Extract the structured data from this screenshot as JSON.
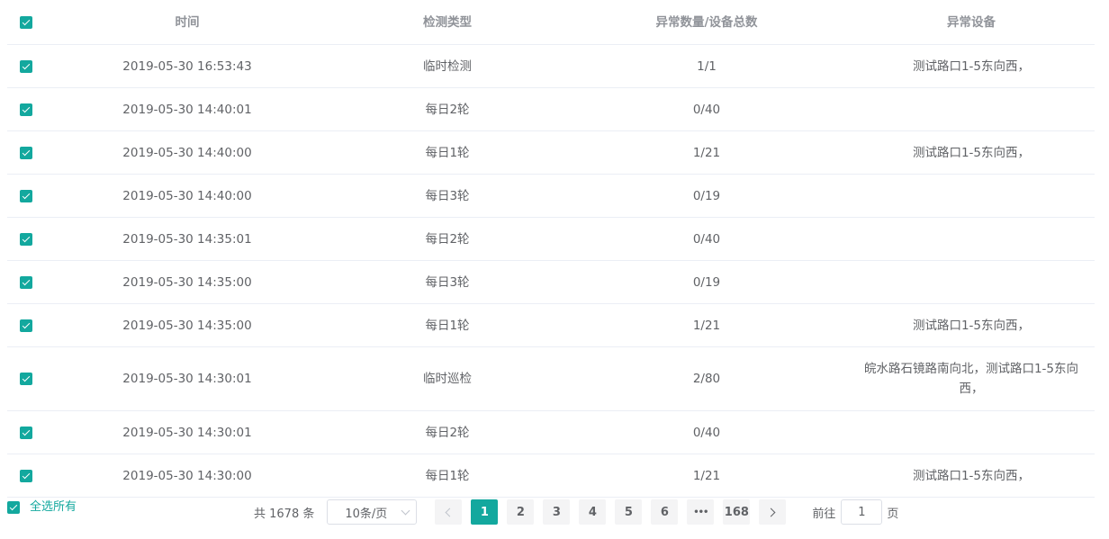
{
  "table": {
    "columns": {
      "time": "时间",
      "type": "检测类型",
      "count": "异常数量/设备总数",
      "device": "异常设备"
    },
    "rows": [
      {
        "time": "2019-05-30 16:53:43",
        "type": "临时检测",
        "count": "1/1",
        "device": "测试路口1-5东向西，"
      },
      {
        "time": "2019-05-30 14:40:01",
        "type": "每日2轮",
        "count": "0/40",
        "device": ""
      },
      {
        "time": "2019-05-30 14:40:00",
        "type": "每日1轮",
        "count": "1/21",
        "device": "测试路口1-5东向西，"
      },
      {
        "time": "2019-05-30 14:40:00",
        "type": "每日3轮",
        "count": "0/19",
        "device": ""
      },
      {
        "time": "2019-05-30 14:35:01",
        "type": "每日2轮",
        "count": "0/40",
        "device": ""
      },
      {
        "time": "2019-05-30 14:35:00",
        "type": "每日3轮",
        "count": "0/19",
        "device": ""
      },
      {
        "time": "2019-05-30 14:35:00",
        "type": "每日1轮",
        "count": "1/21",
        "device": "测试路口1-5东向西，"
      },
      {
        "time": "2019-05-30 14:30:01",
        "type": "临时巡检",
        "count": "2/80",
        "device": "皖水路石镜路南向北，测试路口1-5东向西，"
      },
      {
        "time": "2019-05-30 14:30:01",
        "type": "每日2轮",
        "count": "0/40",
        "device": ""
      },
      {
        "time": "2019-05-30 14:30:00",
        "type": "每日1轮",
        "count": "1/21",
        "device": "测试路口1-5东向西，"
      }
    ]
  },
  "footer": {
    "select_all": "全选所有",
    "total": "共 1678 条",
    "page_size": "10条/页",
    "pages": [
      "1",
      "2",
      "3",
      "4",
      "5",
      "6"
    ],
    "ellipsis": "•••",
    "last_page": "168",
    "current_page": "1",
    "goto_prefix": "前往",
    "goto_value": "1",
    "goto_suffix": "页"
  },
  "colors": {
    "accent": "#13a89e",
    "header_text": "#909399",
    "body_text": "#606266",
    "divider": "#ebeef5"
  },
  "icons": {
    "checkbox": "checkbox-checked-icon",
    "prev": "chevron-left-icon",
    "next": "chevron-right-icon",
    "select_arrow": "chevron-down-icon"
  }
}
